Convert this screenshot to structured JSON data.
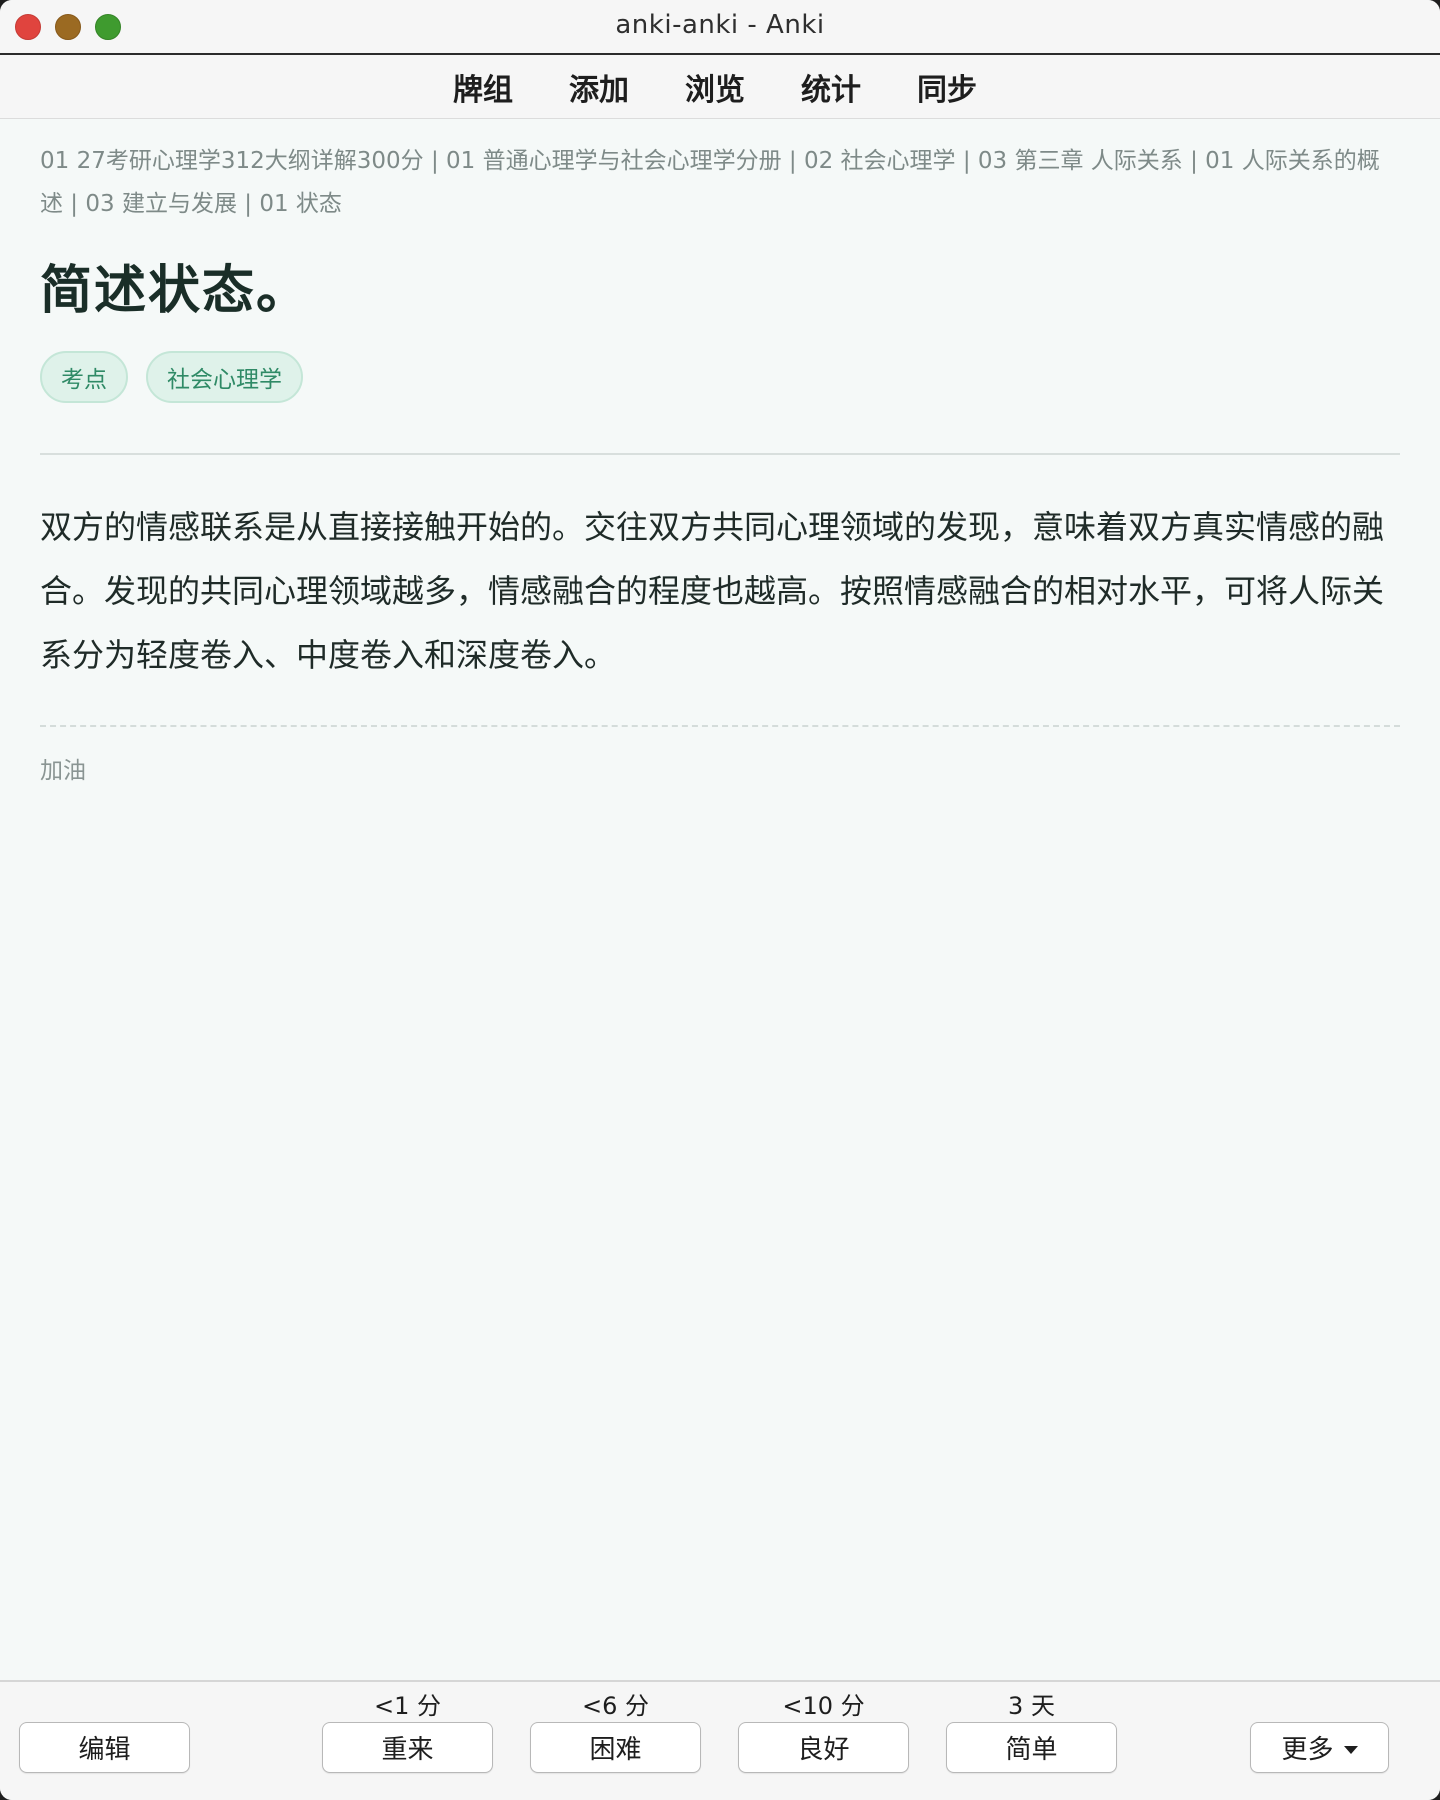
{
  "window": {
    "title": "anki-anki - Anki"
  },
  "toolbar": {
    "items": [
      {
        "label": "牌组"
      },
      {
        "label": "添加"
      },
      {
        "label": "浏览"
      },
      {
        "label": "统计"
      },
      {
        "label": "同步"
      }
    ]
  },
  "card": {
    "breadcrumb": "01 27考研心理学312大纲详解300分 | 01 普通心理学与社会心理学分册 | 02 社会心理学 | 03 第三章 人际关系 | 01 人际关系的概述 | 03 建立与发展 | 01 状态",
    "title": "简述状态。",
    "tags": [
      {
        "label": "考点"
      },
      {
        "label": "社会心理学"
      }
    ],
    "answer": "双方的情感联系是从直接接触开始的。交往双方共同心理领域的发现，意味着双方真实情感的融合。发现的共同心理领域越多，情感融合的程度也越高。按照情感融合的相对水平，可将人际关系分为轻度卷入、中度卷入和深度卷入。",
    "extra": "加油"
  },
  "bottombar": {
    "edit_label": "编辑",
    "more_label": "更多",
    "answers": [
      {
        "interval": "<1 分",
        "label": "重来"
      },
      {
        "interval": "<6 分",
        "label": "困难"
      },
      {
        "interval": "<10 分",
        "label": "良好"
      },
      {
        "interval": "3 天",
        "label": "简单"
      }
    ]
  },
  "colors": {
    "background": "#f5f9f8",
    "tag_bg": "#dff2ea",
    "tag_text": "#2f8a66",
    "title_text": "#1a2e28"
  }
}
